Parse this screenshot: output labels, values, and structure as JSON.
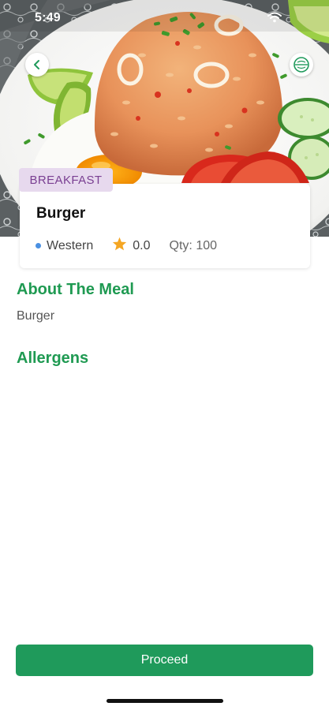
{
  "status_bar": {
    "time": "5:49"
  },
  "meal": {
    "category": "BREAKFAST",
    "name": "Burger",
    "cuisine": "Western",
    "rating": "0.0",
    "quantity": "Qty: 100"
  },
  "about": {
    "heading": "About The Meal",
    "text": "Burger"
  },
  "allergens": {
    "heading": "Allergens"
  },
  "actions": {
    "proceed_label": "Proceed"
  },
  "icons": {
    "back": "chevron-left-icon",
    "halal": "halal-icon",
    "wifi": "wifi-icon",
    "rating": "star-icon",
    "cuisine": "dot-icon"
  },
  "colors": {
    "primary_green": "#1f9a5b",
    "tag_background": "#e7d9ee",
    "tag_text": "#7a3f92",
    "cuisine_dot": "#4a90e2",
    "star": "#f5a623"
  }
}
